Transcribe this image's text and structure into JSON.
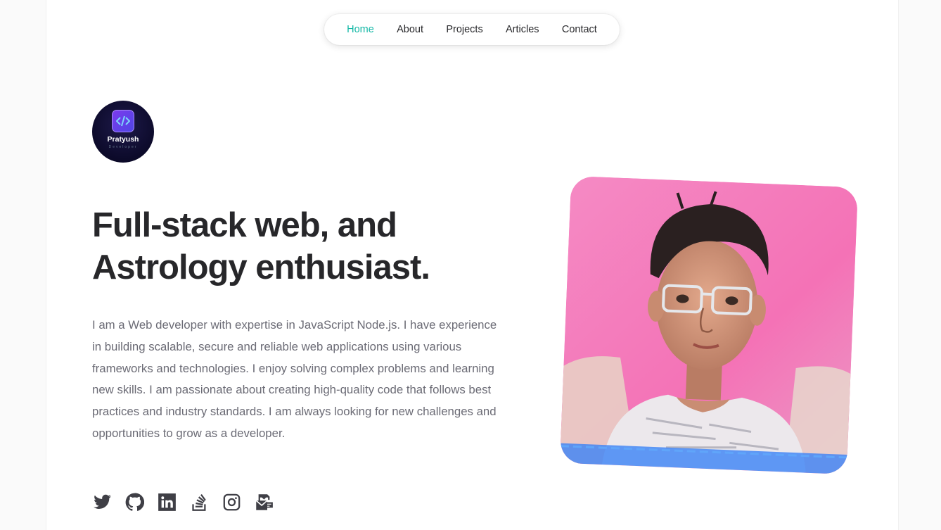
{
  "nav": {
    "items": [
      "Home",
      "About",
      "Projects",
      "Articles",
      "Contact"
    ],
    "active": "Home",
    "active_color": "#14b8a6"
  },
  "avatar": {
    "name": "Pratyush",
    "subtitle": "Developer"
  },
  "hero": {
    "headline_line1": "Full-stack web, and",
    "headline_line2": "Astrology enthusiast.",
    "bio": "I am a Web developer with expertise in JavaScript Node.js. I have experience in building scalable, secure and reliable web applications using various frameworks and technologies. I enjoy solving complex problems and learning new skills. I am passionate about creating high-quality code that follows best practices and industry standards. I am always looking for new challenges and opportunities to grow as a developer."
  },
  "socials": [
    {
      "icon": "twitter-icon"
    },
    {
      "icon": "github-icon"
    },
    {
      "icon": "linkedin-icon"
    },
    {
      "icon": "stackoverflow-icon"
    },
    {
      "icon": "instagram-icon"
    },
    {
      "icon": "mail-icon"
    }
  ],
  "colors": {
    "heading": "#27272a",
    "body": "#6b6b75",
    "photo_background": "#f472b6"
  }
}
